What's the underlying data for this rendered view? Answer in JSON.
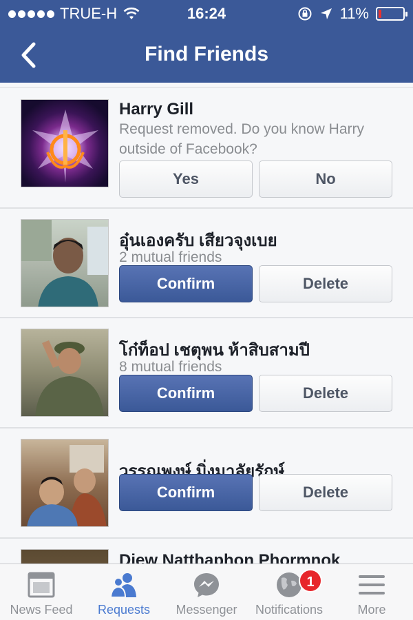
{
  "status_bar": {
    "carrier": "TRUE-H",
    "time": "16:24",
    "battery": "11%",
    "battery_level": 0.11,
    "battery_color": "#e8322f"
  },
  "nav": {
    "title": "Find Friends",
    "back_icon": "chevron-left-icon"
  },
  "requests": [
    {
      "name": "Harry Gill",
      "subtitle": "Request removed. Do you know Harry outside of Facebook?",
      "primary_label": "Yes",
      "secondary_label": "No"
    },
    {
      "name": "อุ๋นเองครับ เสียวจุงเบย",
      "subtitle": "2 mutual friends",
      "primary_label": "Confirm",
      "secondary_label": "Delete"
    },
    {
      "name": "โก๋ท็อป เชตุพน ห้าสิบสามปี",
      "subtitle": "8 mutual friends",
      "primary_label": "Confirm",
      "secondary_label": "Delete"
    },
    {
      "name": "วรรณพงษ์ มิ่งมาลัยรักษ์",
      "primary_label": "Confirm",
      "secondary_label": "Delete"
    },
    {
      "name": "Diew Natthaphon Phormnok"
    }
  ],
  "tab_bar": {
    "tabs": [
      {
        "label": "News Feed",
        "icon": "news-feed-icon"
      },
      {
        "label": "Requests",
        "icon": "requests-icon",
        "active": true
      },
      {
        "label": "Messenger",
        "icon": "messenger-icon"
      },
      {
        "label": "Notifications",
        "icon": "globe-icon",
        "badge": "1"
      },
      {
        "label": "More",
        "icon": "menu-icon"
      }
    ]
  },
  "colors": {
    "brand": "#3b5998",
    "active_tab": "#4a7ad0",
    "badge": "#e7262b"
  }
}
